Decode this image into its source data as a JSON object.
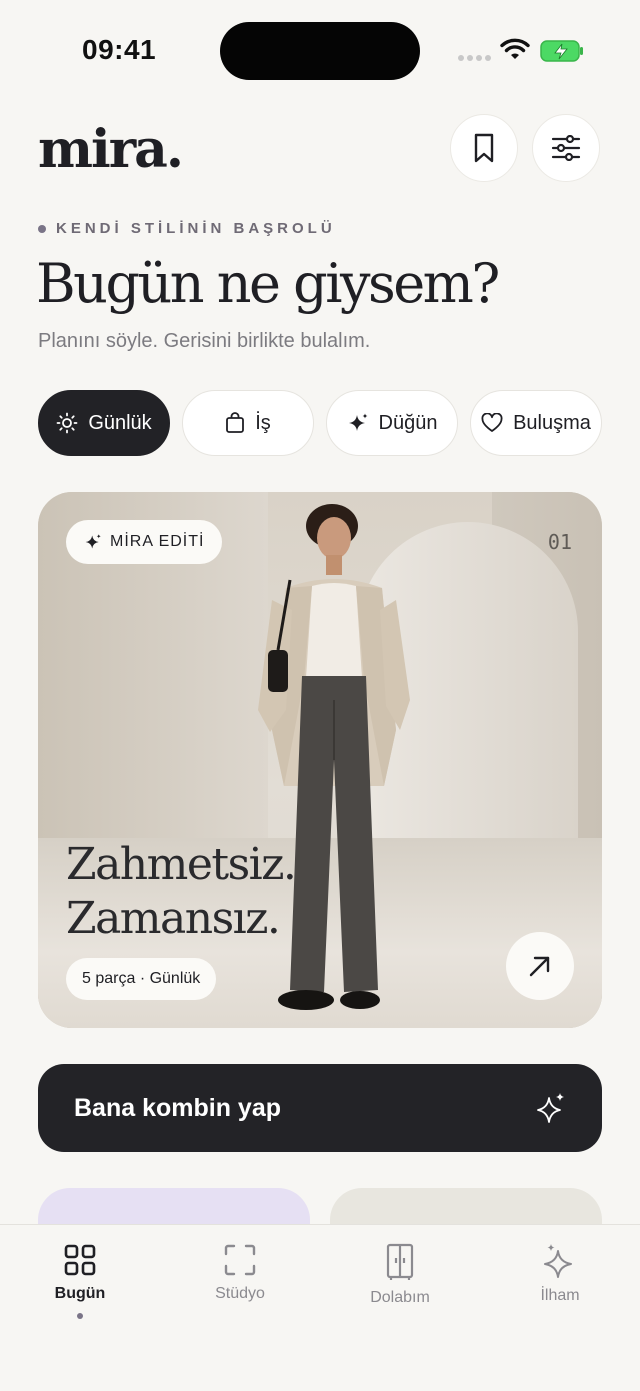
{
  "status_bar": {
    "time": "09:41"
  },
  "header": {
    "logo": "mira."
  },
  "hero_intro": {
    "eyebrow": "KENDİ STİLİNİN BAŞROLÜ",
    "headline": "Bugün ne giysem?",
    "subline": "Planını söyle. Gerisini birlikte bulalım."
  },
  "chips": [
    {
      "label": "Günlük",
      "icon": "sun-icon",
      "active": true
    },
    {
      "label": "İş",
      "icon": "bag-icon",
      "active": false
    },
    {
      "label": "Düğün",
      "icon": "sparkle-icon",
      "active": false
    },
    {
      "label": "Buluşma",
      "icon": "heart-icon",
      "active": false
    }
  ],
  "feature": {
    "badge": "MİRA EDİTİ",
    "number": "01",
    "title_line1": "Zahmetsiz.",
    "title_line2": "Zamansız.",
    "meta": "5 parça · Günlük"
  },
  "cta": {
    "label": "Bana kombin yap"
  },
  "tabs": [
    {
      "label": "Bugün",
      "icon": "grid-icon",
      "active": true
    },
    {
      "label": "Stüdyo",
      "icon": "scan-icon",
      "active": false
    },
    {
      "label": "Dolabım",
      "icon": "wardrobe-icon",
      "active": false
    },
    {
      "label": "İlham",
      "icon": "sparkles-icon",
      "active": false
    }
  ],
  "colors": {
    "ink": "#1f1f24",
    "dark": "#232327",
    "accent": "#7a7487",
    "lilac": "#e6e0f3",
    "background": "#f7f6f3"
  }
}
